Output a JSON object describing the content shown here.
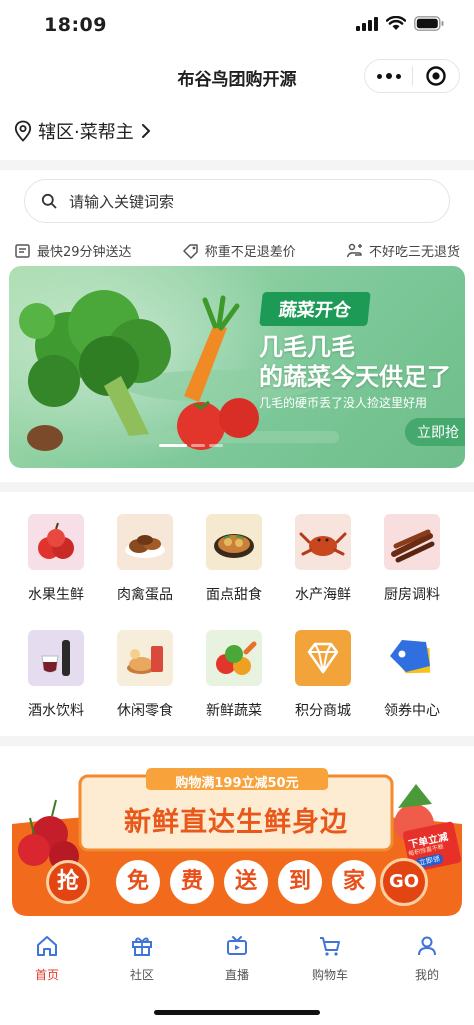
{
  "status": {
    "time": "18:09"
  },
  "header": {
    "title": "布谷鸟团购开源"
  },
  "location": {
    "label": "辖区·菜帮主"
  },
  "search": {
    "placeholder": "请输入关键词索"
  },
  "features": [
    {
      "icon": "delivery-icon",
      "label": "最快29分钟送达"
    },
    {
      "icon": "tag-icon",
      "label": "称重不足退差价"
    },
    {
      "icon": "refund-icon",
      "label": "不好吃三无退货"
    }
  ],
  "banner": {
    "tag": "蔬菜开仓",
    "headline1": "几毛几毛",
    "headline2": "的蔬菜今天供足了",
    "subtitle": "几毛的硬币丢了没人捡这里好用",
    "button": "立即抢"
  },
  "categories": [
    {
      "label": "水果生鲜",
      "icon": "fruit-icon"
    },
    {
      "label": "肉禽蛋品",
      "icon": "meat-icon"
    },
    {
      "label": "面点甜食",
      "icon": "pastry-icon"
    },
    {
      "label": "水产海鲜",
      "icon": "seafood-icon"
    },
    {
      "label": "厨房调料",
      "icon": "seasoning-icon"
    },
    {
      "label": "酒水饮料",
      "icon": "drinks-icon"
    },
    {
      "label": "休闲零食",
      "icon": "snacks-icon"
    },
    {
      "label": "新鲜蔬菜",
      "icon": "vegetables-icon"
    },
    {
      "label": "积分商城",
      "icon": "diamond-icon"
    },
    {
      "label": "领券中心",
      "icon": "coupon-icon"
    }
  ],
  "promo": {
    "top": "购物满199立减50元",
    "main": "新鲜直达生鲜身边",
    "chars": [
      "抢",
      "免",
      "费",
      "送",
      "到",
      "家",
      "GO"
    ],
    "badge1": "下单立减",
    "badge2": "每积惊喜不断",
    "badge3": "立即领"
  },
  "tabbar": [
    {
      "label": "首页",
      "icon": "home-icon",
      "active": true
    },
    {
      "label": "社区",
      "icon": "gift-icon"
    },
    {
      "label": "直播",
      "icon": "live-icon"
    },
    {
      "label": "购物车",
      "icon": "cart-icon"
    },
    {
      "label": "我的",
      "icon": "user-icon"
    }
  ],
  "colors": {
    "accent": "#e8382b",
    "promo": "#f26a1b",
    "banner": "#7fc99a"
  }
}
